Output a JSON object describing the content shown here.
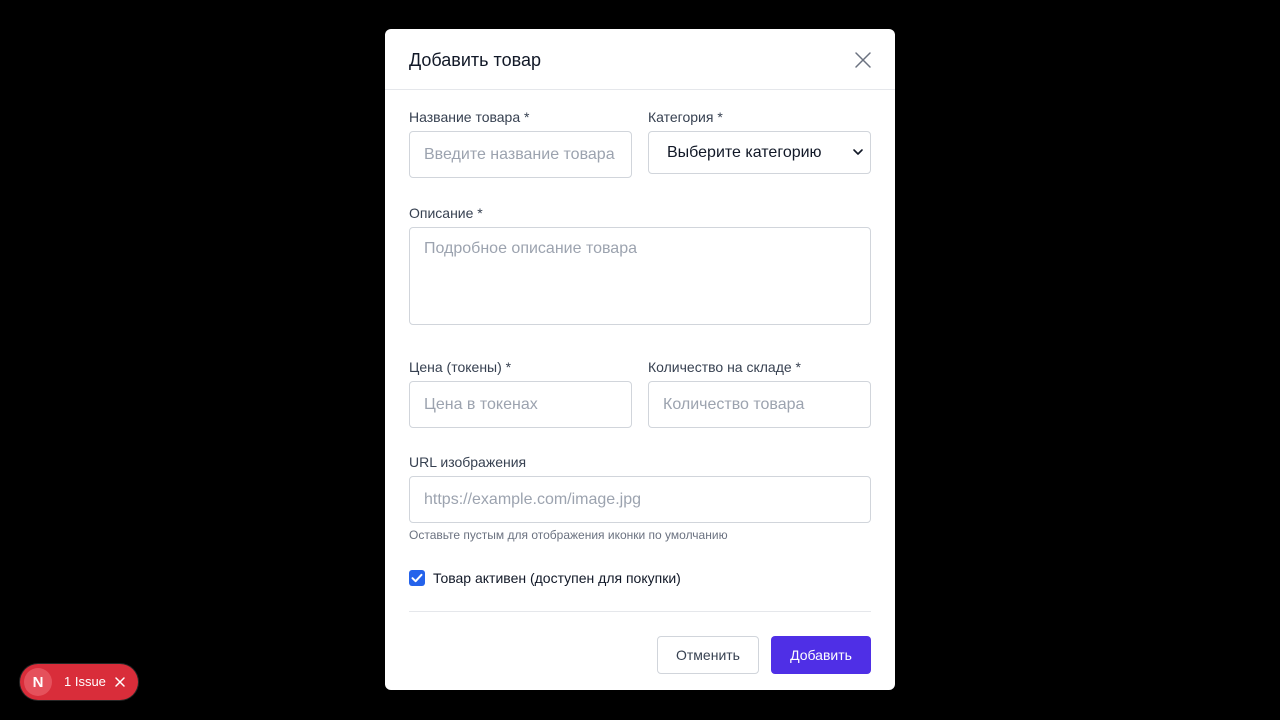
{
  "modal": {
    "title": "Добавить товар"
  },
  "form": {
    "name": {
      "label": "Название товара *",
      "placeholder": "Введите название товара",
      "value": ""
    },
    "category": {
      "label": "Категория *",
      "selected": "Выберите категорию"
    },
    "description": {
      "label": "Описание *",
      "placeholder": "Подробное описание товара",
      "value": ""
    },
    "price": {
      "label": "Цена (токены) *",
      "placeholder": "Цена в токенах",
      "value": ""
    },
    "stock": {
      "label": "Количество на складе *",
      "placeholder": "Количество товара",
      "value": ""
    },
    "image_url": {
      "label": "URL изображения",
      "placeholder": "https://example.com/image.jpg",
      "value": "",
      "hint": "Оставьте пустым для отображения иконки по умолчанию"
    },
    "active": {
      "label": "Товар активен (доступен для покупки)",
      "checked": true
    }
  },
  "buttons": {
    "cancel": "Отменить",
    "submit": "Добавить"
  },
  "issues_badge": {
    "logo": "N",
    "text": "1 Issue"
  },
  "colors": {
    "primary": "#4f2fe6",
    "checkbox": "#2563eb",
    "issue_badge": "#d92d3a",
    "backdrop": "#000000"
  }
}
